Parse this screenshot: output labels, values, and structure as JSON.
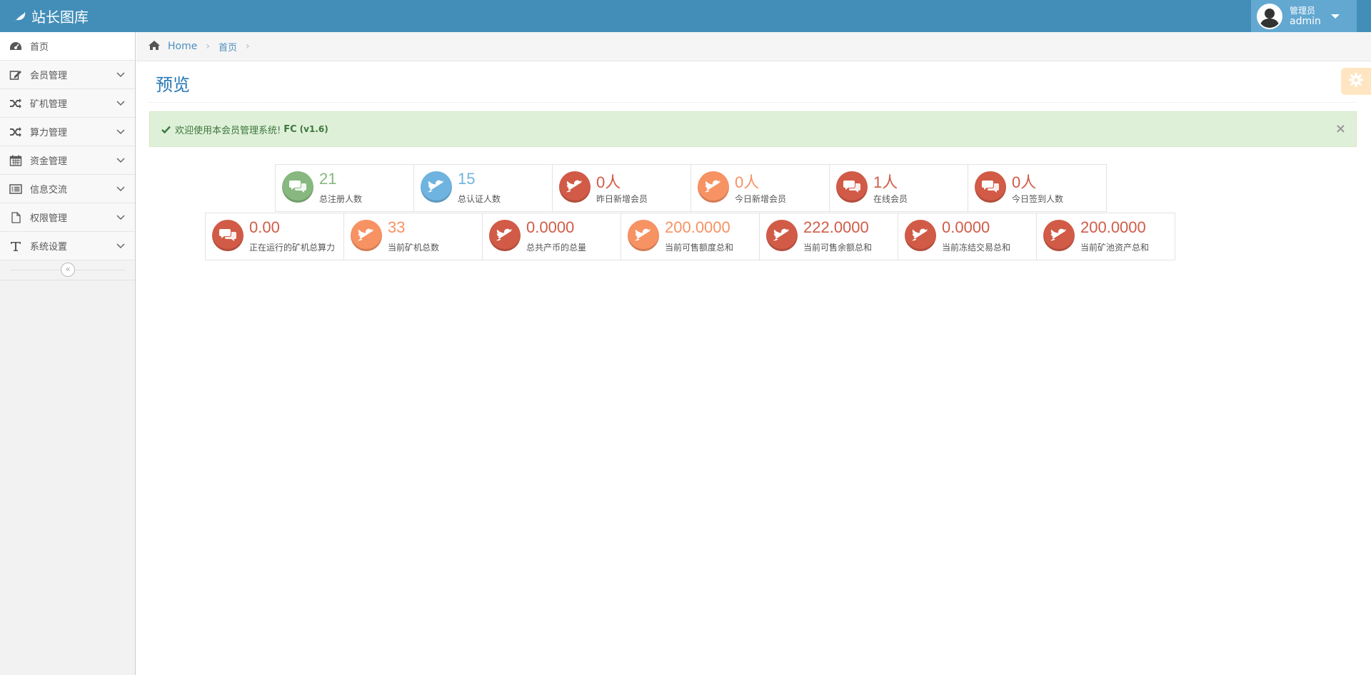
{
  "brand": {
    "title": "站长图库",
    "icon": "leaf-icon"
  },
  "user": {
    "role": "管理员",
    "name": "admin"
  },
  "sidebar": {
    "items": [
      {
        "label": "首页",
        "icon": "dashboard-icon"
      },
      {
        "label": "会员管理",
        "icon": "edit-icon"
      },
      {
        "label": "矿机管理",
        "icon": "shuffle-icon"
      },
      {
        "label": "算力管理",
        "icon": "shuffle-icon"
      },
      {
        "label": "资金管理",
        "icon": "calendar-icon"
      },
      {
        "label": "信息交流",
        "icon": "list-icon"
      },
      {
        "label": "权限管理",
        "icon": "file-icon"
      },
      {
        "label": "系统设置",
        "icon": "text-icon"
      }
    ],
    "collapse_glyph": "«"
  },
  "breadcrumb": {
    "home": "Home",
    "current": "首页",
    "sep": "›"
  },
  "page": {
    "title": "预览"
  },
  "alert": {
    "text": "欢迎使用本会员管理系统!",
    "app": "FC",
    "version": "(v1.6)",
    "close": "×"
  },
  "stats_row1": [
    {
      "value": "21",
      "label": "总注册人数",
      "color": "#87b87f",
      "icon": "comments-icon"
    },
    {
      "value": "15",
      "label": "总认证人数",
      "color": "#6fb3e0",
      "icon": "twitter-icon"
    },
    {
      "value": "0人",
      "label": "昨日新增会员",
      "color": "#d15b47",
      "icon": "twitter-icon"
    },
    {
      "value": "0人",
      "label": "今日新增会员",
      "color": "#f79263",
      "icon": "twitter-icon"
    },
    {
      "value": "1人",
      "label": "在线会员",
      "color": "#d15b47",
      "icon": "comments-icon"
    },
    {
      "value": "0人",
      "label": "今日签到人数",
      "color": "#d15b47",
      "icon": "comments-icon"
    }
  ],
  "stats_row2": [
    {
      "value": "0.00",
      "label": "正在运行的矿机总算力",
      "color": "#d15b47",
      "icon": "comments-icon"
    },
    {
      "value": "33",
      "label": "当前矿机总数",
      "color": "#f79263",
      "icon": "twitter-icon"
    },
    {
      "value": "0.0000",
      "label": "总共产币的总量",
      "color": "#d15b47",
      "icon": "twitter-icon"
    },
    {
      "value": "200.0000",
      "label": "当前可售额度总和",
      "color": "#f79263",
      "icon": "twitter-icon"
    },
    {
      "value": "222.0000",
      "label": "当前可售余额总和",
      "color": "#d15b47",
      "icon": "twitter-icon"
    },
    {
      "value": "0.0000",
      "label": "当前冻结交易总和",
      "color": "#d15b47",
      "icon": "twitter-icon"
    },
    {
      "value": "200.0000",
      "label": "当前矿池资产总和",
      "color": "#d15b47",
      "icon": "twitter-icon"
    }
  ],
  "colors": {
    "navbar": "#438eb9",
    "accent": "#2679b5",
    "success_bg": "#dff0d8"
  }
}
